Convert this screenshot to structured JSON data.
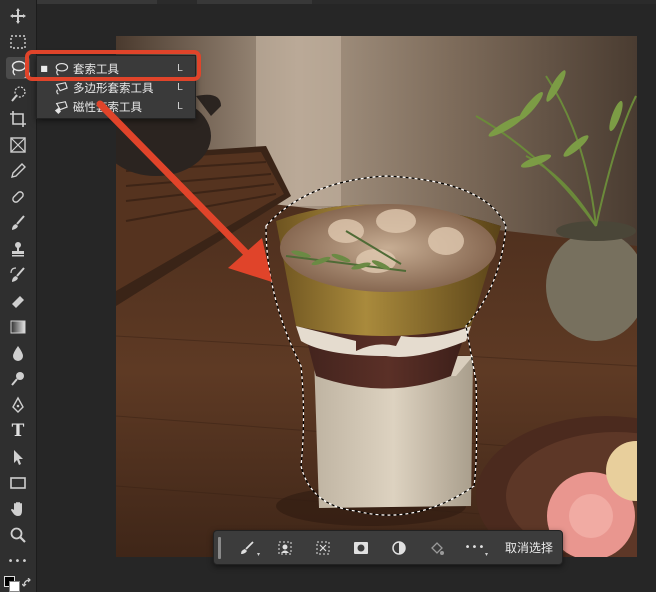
{
  "toolbar": {
    "tools": [
      {
        "name": "move-icon"
      },
      {
        "name": "rectangular-marquee-icon"
      },
      {
        "name": "lasso-icon",
        "active": true
      },
      {
        "name": "quick-selection-icon"
      },
      {
        "name": "crop-icon"
      },
      {
        "name": "frame-icon"
      },
      {
        "name": "eyedropper-icon"
      },
      {
        "name": "healing-brush-icon"
      },
      {
        "name": "brush-icon"
      },
      {
        "name": "clone-stamp-icon"
      },
      {
        "name": "history-brush-icon"
      },
      {
        "name": "eraser-icon"
      },
      {
        "name": "gradient-icon"
      },
      {
        "name": "blur-icon"
      },
      {
        "name": "dodge-icon"
      },
      {
        "name": "pen-icon"
      },
      {
        "name": "type-icon"
      },
      {
        "name": "path-selection-icon"
      },
      {
        "name": "rectangle-shape-icon"
      },
      {
        "name": "hand-icon"
      },
      {
        "name": "zoom-icon"
      },
      {
        "name": "more-tools-icon"
      }
    ],
    "type_glyph": "T",
    "more_glyph": "•••"
  },
  "flyout": {
    "items": [
      {
        "label": "套索工具",
        "shortcut": "L",
        "selected": true,
        "icon": "lasso-icon"
      },
      {
        "label": "多边形套索工具",
        "shortcut": "L",
        "selected": false,
        "icon": "polygonal-lasso-icon"
      },
      {
        "label": "磁性套索工具",
        "shortcut": "L",
        "selected": false,
        "icon": "magnetic-lasso-icon"
      }
    ],
    "bullet": "■"
  },
  "taskbar": {
    "buttons": [
      {
        "name": "refine-brush-icon"
      },
      {
        "name": "select-subject-icon"
      },
      {
        "name": "transform-selection-icon"
      },
      {
        "name": "mask-icon"
      },
      {
        "name": "invert-selection-icon"
      },
      {
        "name": "fill-selection-icon"
      },
      {
        "name": "more-options-icon"
      }
    ],
    "more_glyph": "•••",
    "deselect_label": "取消选择"
  },
  "colors": {
    "accent": "#e0442a",
    "panel": "#2f2f2f",
    "background": "#262626"
  }
}
